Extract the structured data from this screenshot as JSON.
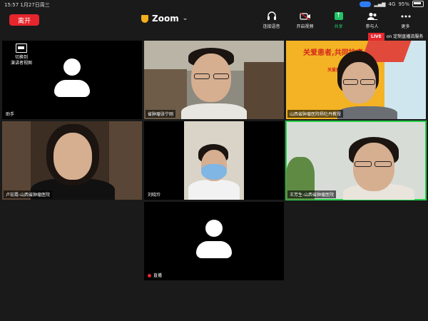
{
  "status_bar": {
    "time": "15:57",
    "date": "1月27日周三",
    "network": "4G",
    "battery": "95%"
  },
  "toolbar": {
    "leave_label": "离开",
    "title": "Zoom",
    "tools": [
      {
        "label": "连接语音",
        "icon": "headphones-icon"
      },
      {
        "label": "开启视频",
        "icon": "video-off-icon"
      },
      {
        "label": "共享",
        "icon": "share-screen-icon"
      },
      {
        "label": "参与人",
        "icon": "participants-icon"
      },
      {
        "label": "更多",
        "icon": "more-icon"
      }
    ]
  },
  "live": {
    "badge": "LIVE",
    "service": "on 定制直播流服务"
  },
  "switch_view": {
    "line1": "切换到",
    "line2": "演讲者视图"
  },
  "participants": [
    {
      "name": "助手",
      "video": false,
      "active": false
    },
    {
      "name": "省肿瘤张宁刚",
      "video": true,
      "active": false
    },
    {
      "name": "山西省肿瘤医院杨牡丹教授",
      "video": true,
      "active": false
    },
    {
      "name": "卢宏霞-山西省肿瘤医院",
      "video": true,
      "active": false
    },
    {
      "name": "刘晓玲",
      "video": true,
      "active": false
    },
    {
      "name": "王芳生-山西省肿瘤医院",
      "video": true,
      "active": true
    },
    {
      "name": "直播",
      "video": false,
      "active": false
    }
  ],
  "poster": {
    "headline": "关爱患者,共同抗癌",
    "subline": "关爱患者 · 呵"
  },
  "colors": {
    "leave": "#e5262d",
    "active_speaker": "#24d04a",
    "share": "#23c165",
    "live": "#e5262d"
  }
}
